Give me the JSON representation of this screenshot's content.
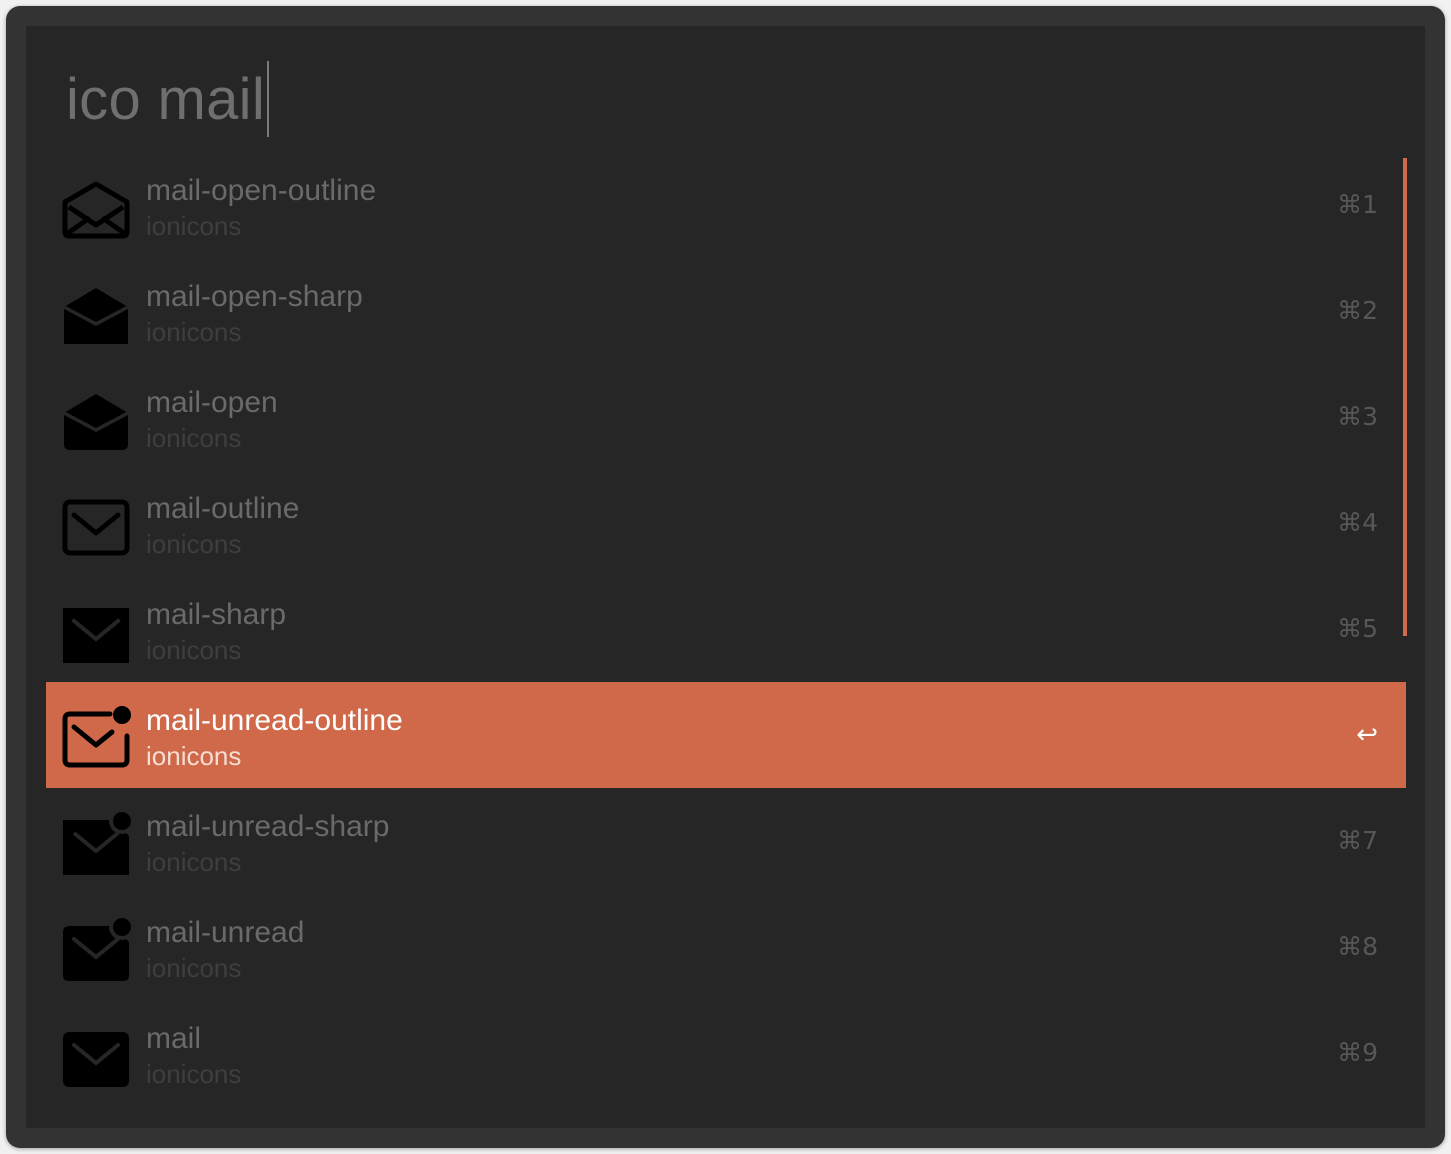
{
  "search": {
    "query": "ico mail"
  },
  "accent_color": "#d0684a",
  "results": [
    {
      "title": "mail-open-outline",
      "subtitle": "ionicons",
      "shortcut": "⌘1",
      "icon": "mail-open-outline-icon",
      "selected": false
    },
    {
      "title": "mail-open-sharp",
      "subtitle": "ionicons",
      "shortcut": "⌘2",
      "icon": "mail-open-sharp-icon",
      "selected": false
    },
    {
      "title": "mail-open",
      "subtitle": "ionicons",
      "shortcut": "⌘3",
      "icon": "mail-open-icon",
      "selected": false
    },
    {
      "title": "mail-outline",
      "subtitle": "ionicons",
      "shortcut": "⌘4",
      "icon": "mail-outline-icon",
      "selected": false
    },
    {
      "title": "mail-sharp",
      "subtitle": "ionicons",
      "shortcut": "⌘5",
      "icon": "mail-sharp-icon",
      "selected": false
    },
    {
      "title": "mail-unread-outline",
      "subtitle": "ionicons",
      "shortcut": "↩",
      "icon": "mail-unread-outline-icon",
      "selected": true
    },
    {
      "title": "mail-unread-sharp",
      "subtitle": "ionicons",
      "shortcut": "⌘7",
      "icon": "mail-unread-sharp-icon",
      "selected": false
    },
    {
      "title": "mail-unread",
      "subtitle": "ionicons",
      "shortcut": "⌘8",
      "icon": "mail-unread-icon",
      "selected": false
    },
    {
      "title": "mail",
      "subtitle": "ionicons",
      "shortcut": "⌘9",
      "icon": "mail-icon",
      "selected": false
    }
  ]
}
